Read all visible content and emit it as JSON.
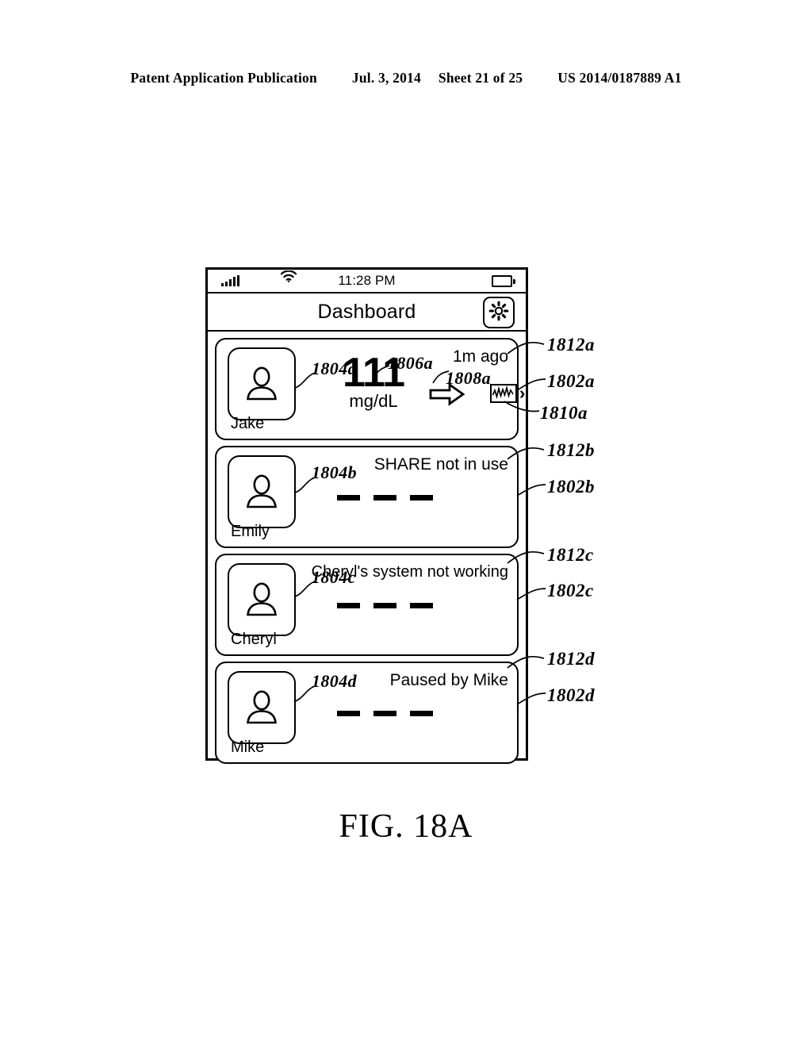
{
  "page_header": {
    "publication": "Patent Application Publication",
    "date": "Jul. 3, 2014",
    "sheet": "Sheet 21 of 25",
    "patent_number": "US 2014/0187889 A1"
  },
  "figure": {
    "caption": "FIG. 18A"
  },
  "phone": {
    "status_bar": {
      "signal_icon": "signal-bars-icon",
      "wifi_icon": "wifi-icon",
      "time": "11:28 PM",
      "battery_icon": "battery-icon"
    },
    "title_bar": {
      "title": "Dashboard",
      "settings_icon": "gear-icon"
    },
    "cards": [
      {
        "name": "Jake",
        "avatar_icon": "person-avatar-icon",
        "value": "111",
        "units": "mg/dL",
        "trend_arrow_icon": "arrow-right-flat-icon",
        "status": "1m ago",
        "graph_icon": "trend-graph-icon",
        "chevron_icon": "chevron-right-icon"
      },
      {
        "name": "Emily",
        "avatar_icon": "person-avatar-icon",
        "value": "— — —",
        "status": "SHARE not in use"
      },
      {
        "name": "Cheryl",
        "avatar_icon": "person-avatar-icon",
        "value": "— — —",
        "status": "Cheryl's system not working"
      },
      {
        "name": "Mike",
        "avatar_icon": "person-avatar-icon",
        "value": "— — —",
        "status": "Paused by Mike"
      }
    ]
  },
  "reference_numerals": {
    "inner": {
      "avatar_a": "1804a",
      "value_a": "1806a",
      "arrow_a": "1808a",
      "avatar_b": "1804b",
      "avatar_c": "1804c",
      "avatar_d": "1804d"
    },
    "outer": {
      "status_a": "1812a",
      "card_a": "1802a",
      "graph_a": "1810a",
      "status_b": "1812b",
      "card_b": "1802b",
      "status_c": "1812c",
      "card_c": "1802c",
      "status_d": "1812d",
      "card_d": "1802d"
    }
  }
}
